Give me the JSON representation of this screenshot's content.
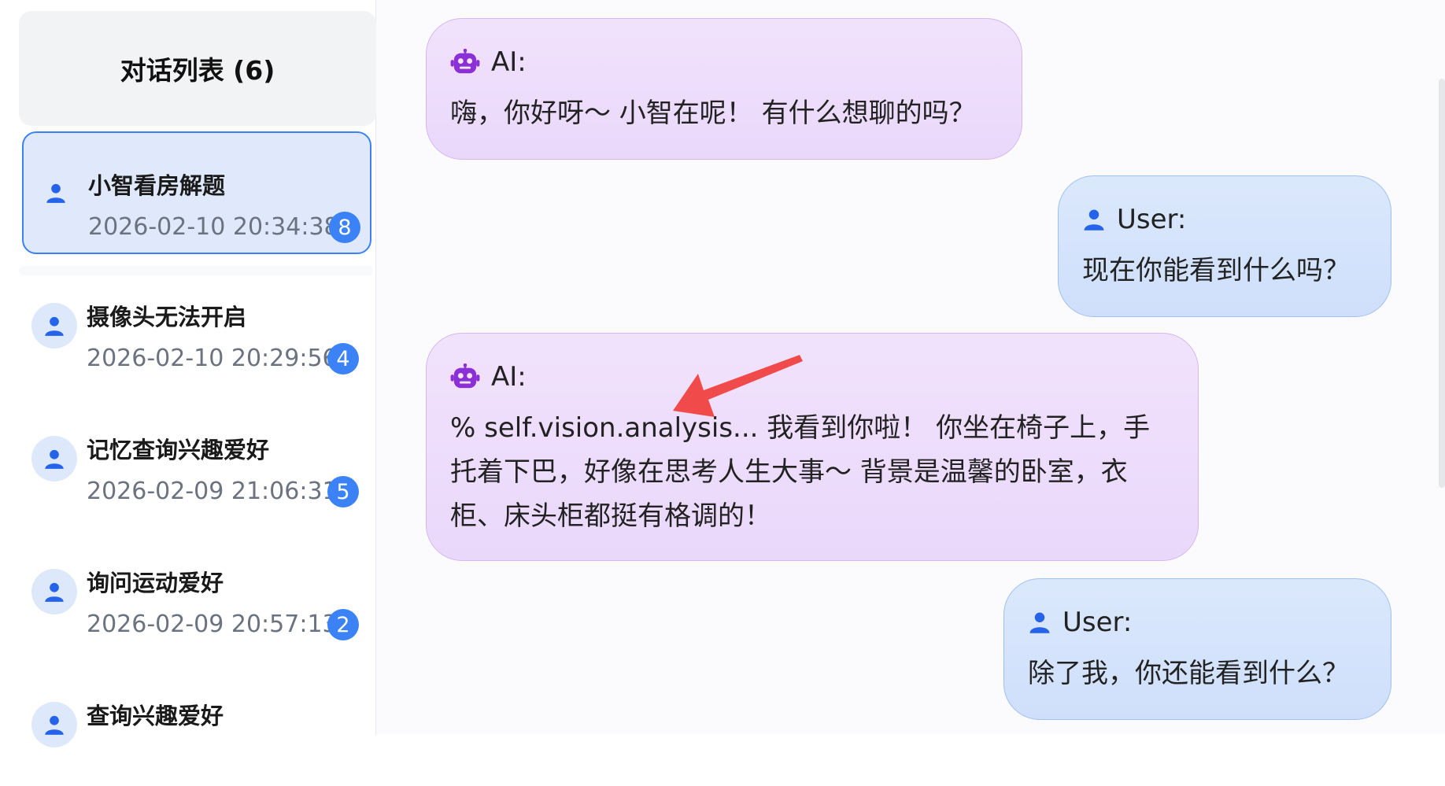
{
  "sidebar": {
    "header": "对话列表 (6)",
    "conversations": [
      {
        "title": "小智看房解题",
        "time": "2026-02-10 20:34:38",
        "count": "8",
        "active": true
      },
      {
        "title": "摄像头无法开启",
        "time": "2026-02-10 20:29:56",
        "count": "4"
      },
      {
        "title": "记忆查询兴趣爱好",
        "time": "2026-02-09 21:06:31",
        "count": "5"
      },
      {
        "title": "询问运动爱好",
        "time": "2026-02-09 20:57:13",
        "count": "2"
      },
      {
        "title": "查询兴趣爱好",
        "time": "",
        "count": ""
      }
    ]
  },
  "chat": {
    "messages": [
      {
        "role": "ai",
        "speaker": "AI:",
        "text": "嗨，你好呀～ 小智在呢！ 有什么想聊的吗？"
      },
      {
        "role": "user",
        "speaker": "User:",
        "text": "现在你能看到什么吗？"
      },
      {
        "role": "ai",
        "speaker": "AI:",
        "text": "% self.vision.analysis... 我看到你啦！ 你坐在椅子上，手托着下巴，好像在思考人生大事～ 背景是温馨的卧室，衣柜、床头柜都挺有格调的！"
      },
      {
        "role": "user",
        "speaker": "User:",
        "text": "除了我，你还能看到什么？"
      }
    ]
  },
  "icons": {
    "ai": "robot-icon",
    "user": "person-icon"
  },
  "colors": {
    "accent": "#3b82f6",
    "ai_icon": "#8b2fd6",
    "user_icon": "#2563eb",
    "arrow": "#f04a4a"
  }
}
